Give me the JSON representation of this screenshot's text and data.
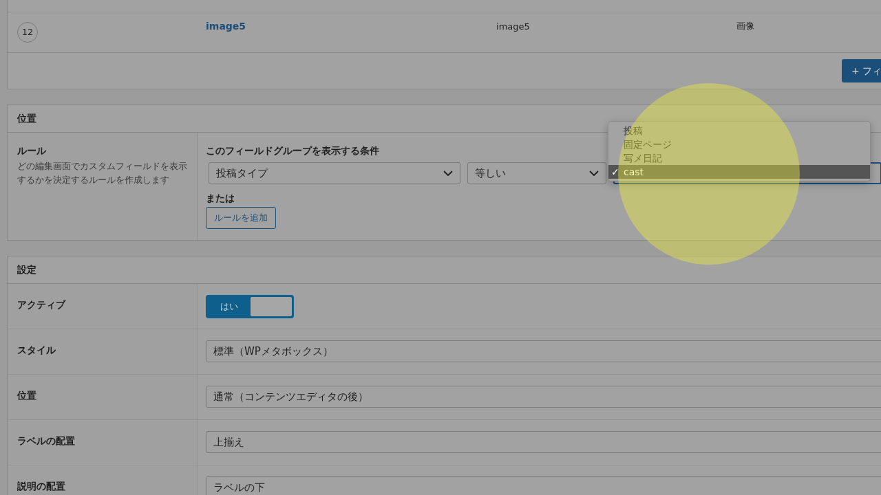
{
  "fields_table": {
    "rows": [
      {
        "order": "12",
        "label": "image5",
        "name": "image5",
        "type": "画像"
      }
    ],
    "add_button": "+ フィ"
  },
  "location": {
    "title": "位置",
    "rule_label": "ルール",
    "rule_description": "どの編集画面でカスタムフィールドを表示するかを決定するルールを作成します",
    "condition_heading": "このフィールドグループを表示する条件",
    "selects": [
      {
        "value": "投稿タイプ",
        "focused": false
      },
      {
        "value": "等しい",
        "focused": false
      },
      {
        "focused": true
      }
    ],
    "or_label": "または",
    "add_rule_button": "ルールを追加",
    "dropdown": {
      "check_mark": "✓",
      "options": [
        {
          "label": "投稿",
          "selected": false
        },
        {
          "label": "固定ページ",
          "selected": false
        },
        {
          "label": "写メ日記",
          "selected": false
        },
        {
          "label": "cast",
          "selected": true
        }
      ]
    }
  },
  "settings": {
    "title": "設定",
    "rows": [
      {
        "kind": "toggle",
        "label": "アクティブ",
        "value": "はい",
        "on": true
      },
      {
        "kind": "select",
        "label": "スタイル",
        "value": "標準（WPメタボックス）"
      },
      {
        "kind": "select",
        "label": "位置",
        "value": "通常（コンテンツエディタの後）"
      },
      {
        "kind": "select",
        "label": "ラベルの配置",
        "value": "上揃え"
      },
      {
        "kind": "select",
        "label": "説明の配置",
        "value": "ラベルの下"
      }
    ]
  },
  "cursor_highlight": {
    "visible": true
  }
}
